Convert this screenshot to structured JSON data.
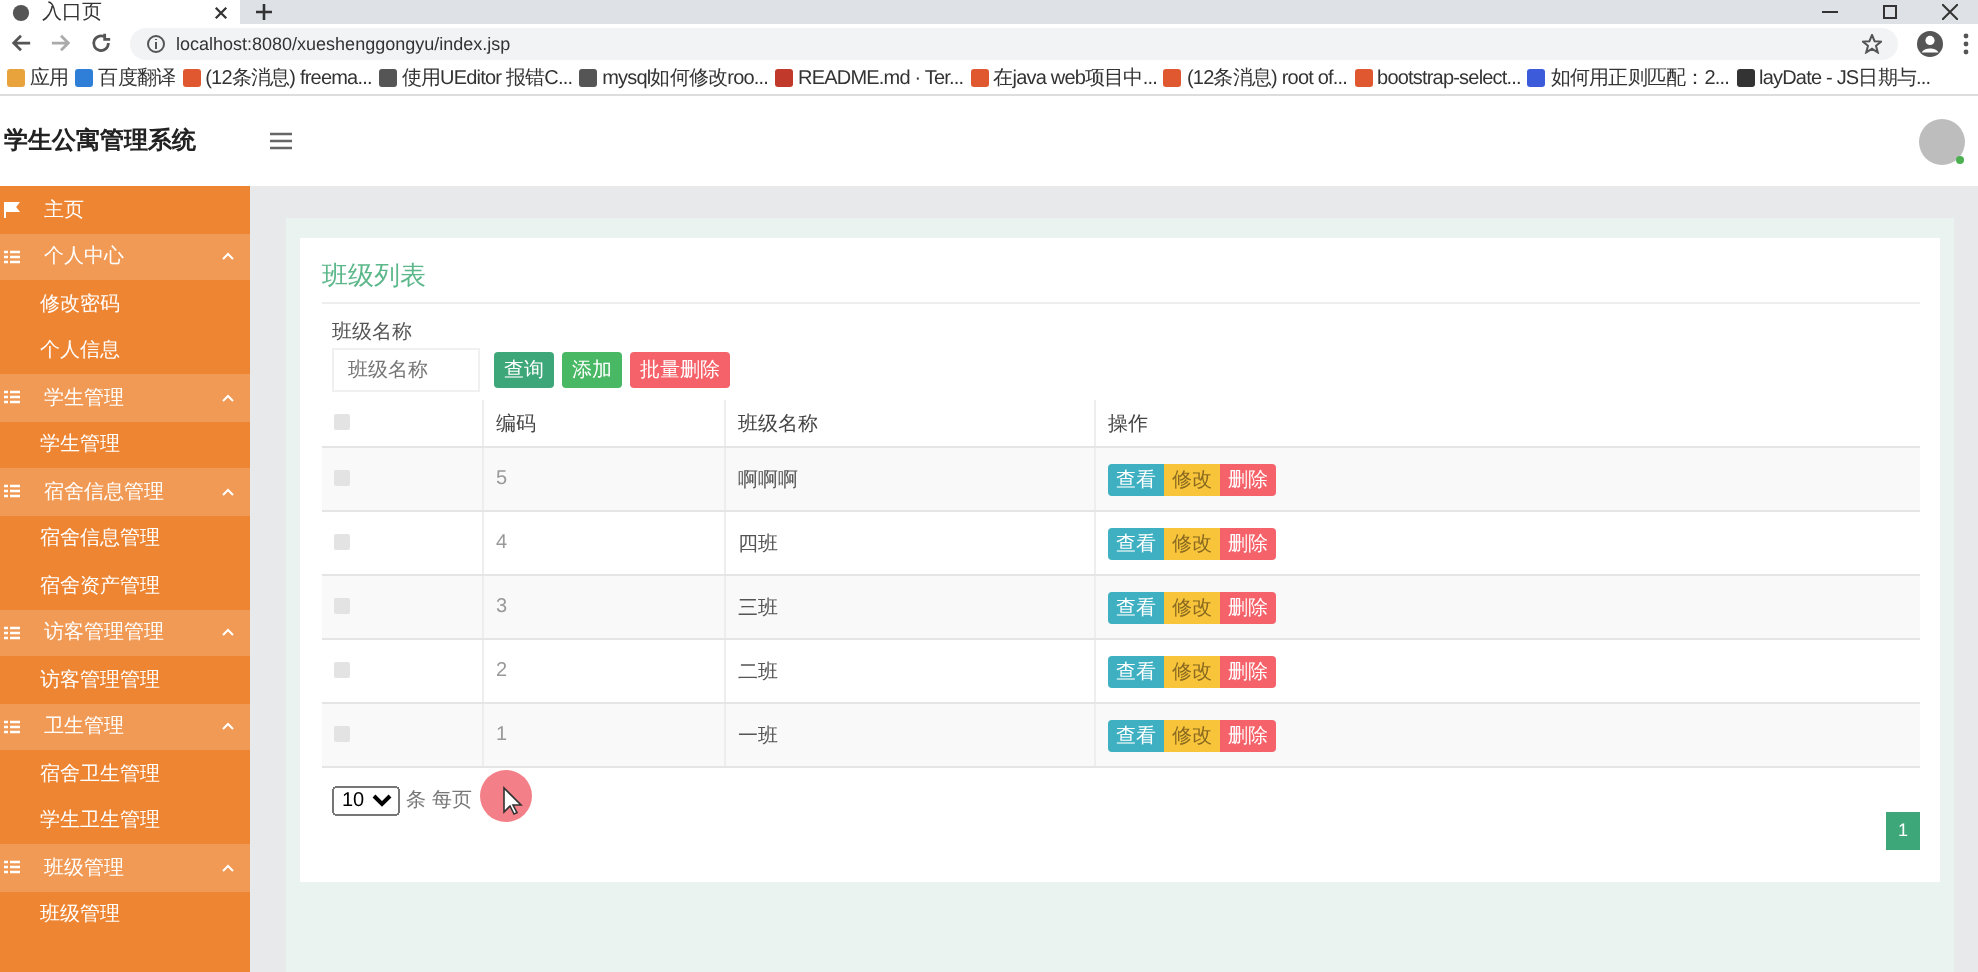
{
  "browser": {
    "tab_title": "入口页",
    "url": "localhost:8080/xueshenggongyu/index.jsp",
    "bookmarks": [
      {
        "label": "应用",
        "kind": "apps"
      },
      {
        "label": "百度翻译",
        "kind": "blue"
      },
      {
        "label": "(12条消息) freema...",
        "kind": "red"
      },
      {
        "label": "使用UEditor 报错C...",
        "kind": "line"
      },
      {
        "label": "mysql如何修改roo...",
        "kind": "line"
      },
      {
        "label": "README.md · Ter...",
        "kind": "circle"
      },
      {
        "label": "在java web项目中...",
        "kind": "red"
      },
      {
        "label": "(12条消息) root of...",
        "kind": "red"
      },
      {
        "label": "bootstrap-select...",
        "kind": "red"
      },
      {
        "label": "如何用正则匹配：2...",
        "kind": "paw"
      },
      {
        "label": "layDate - JS日期与...",
        "kind": "dark"
      }
    ]
  },
  "header": {
    "title": "学生公寓管理系统"
  },
  "sidebar": {
    "items": [
      {
        "label": "主页",
        "kind": "link"
      },
      {
        "label": "个人中心",
        "kind": "group",
        "expanded": true,
        "children": [
          {
            "label": "修改密码"
          },
          {
            "label": "个人信息"
          }
        ]
      },
      {
        "label": "学生管理",
        "kind": "group",
        "expanded": true,
        "children": [
          {
            "label": "学生管理"
          }
        ]
      },
      {
        "label": "宿舍信息管理",
        "kind": "group",
        "expanded": true,
        "children": [
          {
            "label": "宿舍信息管理"
          },
          {
            "label": "宿舍资产管理"
          }
        ]
      },
      {
        "label": "访客管理管理",
        "kind": "group",
        "expanded": true,
        "children": [
          {
            "label": "访客管理管理"
          }
        ]
      },
      {
        "label": "卫生管理",
        "kind": "group",
        "expanded": true,
        "children": [
          {
            "label": "宿舍卫生管理"
          },
          {
            "label": "学生卫生管理"
          }
        ]
      },
      {
        "label": "班级管理",
        "kind": "group",
        "expanded": true,
        "children": [
          {
            "label": "班级管理"
          }
        ]
      }
    ]
  },
  "page": {
    "title": "班级列表",
    "search": {
      "label": "班级名称",
      "placeholder": "班级名称"
    },
    "buttons": [
      {
        "label": "查询",
        "kind": "query"
      },
      {
        "label": "添加",
        "kind": "add"
      },
      {
        "label": "批量删除",
        "kind": "delete"
      }
    ],
    "table": {
      "header_checked": false,
      "columns": [
        "编码",
        "班级名称",
        "操作"
      ],
      "rows": [
        {
          "checked": false,
          "cells": [
            "5",
            "啊啊啊"
          ],
          "actions": [
            {
              "label": "查看",
              "kind": "view"
            },
            {
              "label": "修改",
              "kind": "edit"
            },
            {
              "label": "删除",
              "kind": "delete"
            }
          ]
        },
        {
          "checked": false,
          "cells": [
            "4",
            "四班"
          ],
          "actions": [
            {
              "label": "查看",
              "kind": "view"
            },
            {
              "label": "修改",
              "kind": "edit"
            },
            {
              "label": "删除",
              "kind": "delete"
            }
          ]
        },
        {
          "checked": false,
          "cells": [
            "3",
            "三班"
          ],
          "actions": [
            {
              "label": "查看",
              "kind": "view"
            },
            {
              "label": "修改",
              "kind": "edit"
            },
            {
              "label": "删除",
              "kind": "delete"
            }
          ]
        },
        {
          "checked": false,
          "cells": [
            "2",
            "二班"
          ],
          "actions": [
            {
              "label": "查看",
              "kind": "view"
            },
            {
              "label": "修改",
              "kind": "edit"
            },
            {
              "label": "删除",
              "kind": "delete"
            }
          ]
        },
        {
          "checked": false,
          "cells": [
            "1",
            "一班"
          ],
          "actions": [
            {
              "label": "查看",
              "kind": "view"
            },
            {
              "label": "修改",
              "kind": "edit"
            },
            {
              "label": "删除",
              "kind": "delete"
            }
          ]
        }
      ]
    },
    "pagination": {
      "page_size": "10",
      "page_size_suffix": "条 每页",
      "pages": [
        {
          "label": "1",
          "selected": true
        }
      ]
    }
  }
}
